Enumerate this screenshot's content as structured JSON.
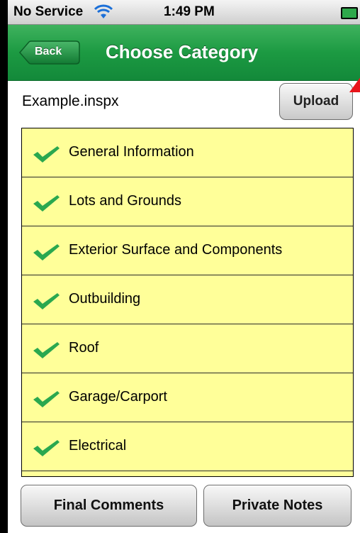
{
  "status_bar": {
    "carrier": "No Service",
    "time": "1:49 PM"
  },
  "nav": {
    "back_label": "Back",
    "title": "Choose Category"
  },
  "file": {
    "name": "Example.inspx",
    "upload_label": "Upload"
  },
  "categories": [
    {
      "label": "General Information",
      "checked": true
    },
    {
      "label": "Lots and Grounds",
      "checked": true
    },
    {
      "label": "Exterior Surface and Components",
      "checked": true
    },
    {
      "label": "Outbuilding",
      "checked": true
    },
    {
      "label": "Roof",
      "checked": true
    },
    {
      "label": "Garage/Carport",
      "checked": true
    },
    {
      "label": "Electrical",
      "checked": true
    }
  ],
  "footer": {
    "final_comments_label": "Final Comments",
    "private_notes_label": "Private Notes"
  },
  "colors": {
    "nav_green": "#1c9a42",
    "list_background": "#ffff99",
    "check_green": "#2aa84f",
    "flag_red": "#e8141a"
  }
}
